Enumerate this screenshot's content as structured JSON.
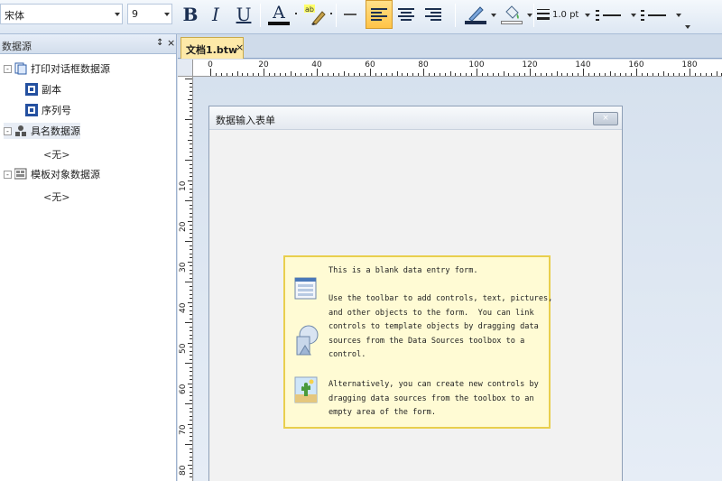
{
  "toolbar": {
    "font_name": "宋体",
    "font_size": "9",
    "bold_label": "B",
    "italic_label": "I",
    "underline_label": "U",
    "font_color_label": "A",
    "highlight_label": "ab",
    "line_width": "1.0 pt"
  },
  "left_panel": {
    "title": "数据源",
    "pin_icon": "pin-icon",
    "tree": [
      {
        "label": "打印对话框数据源",
        "expander": "-",
        "children": [
          {
            "label": "副本"
          },
          {
            "label": "序列号"
          }
        ]
      },
      {
        "label": "具名数据源",
        "expander": "-",
        "children": [],
        "empty": "<无>"
      },
      {
        "label": "模板对象数据源",
        "expander": "-",
        "children": [],
        "empty": "<无>"
      }
    ]
  },
  "document": {
    "tab_label": "文档1.btw",
    "tab_close": "×"
  },
  "rulers": {
    "horizontal": [
      "0",
      "20",
      "40",
      "60",
      "80",
      "100",
      "120",
      "140",
      "160",
      "180"
    ],
    "vertical": [
      "10",
      "20",
      "30",
      "40",
      "50",
      "60",
      "70",
      "80"
    ]
  },
  "form_window": {
    "title": "数据输入表单",
    "close_label": "×"
  },
  "info_box": {
    "line1": "This is a blank data entry form.",
    "para2": "Use the toolbar to add controls, text, pictures,\nand other objects to the form.  You can link\ncontrols to template objects by dragging data\nsources from the Data Sources toolbox to a\ncontrol.",
    "para3": "Alternatively, you can create new controls by\ndragging data sources from the toolbox to an\nempty area of the form."
  },
  "colors": {
    "accent_tab": "#fde9a8",
    "info_bg": "#fffbd4",
    "info_border": "#e9cf4d"
  }
}
